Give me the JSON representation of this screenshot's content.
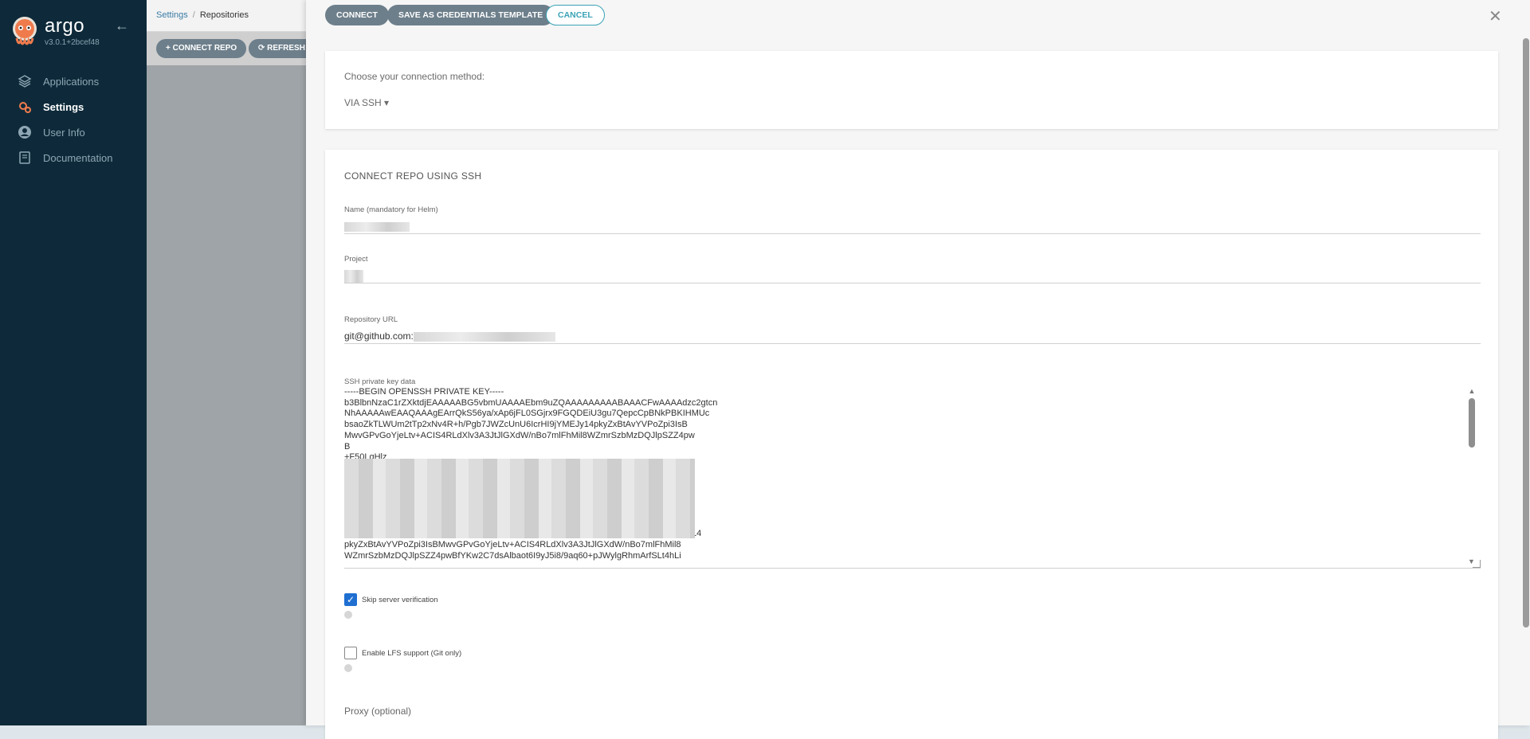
{
  "sidebar": {
    "logo_name": "argo",
    "version": "v3.0.1+2bcef48",
    "items": [
      {
        "label": "Applications",
        "icon": "layers-icon"
      },
      {
        "label": "Settings",
        "icon": "gears-icon",
        "active": true
      },
      {
        "label": "User Info",
        "icon": "user-circle-icon"
      },
      {
        "label": "Documentation",
        "icon": "book-icon"
      }
    ]
  },
  "breadcrumb": {
    "parent": "Settings",
    "current": "Repositories"
  },
  "toolbar": {
    "connect_repo": "+ CONNECT REPO",
    "refresh": "⟳ REFRESH"
  },
  "panel": {
    "connect_label": "CONNECT",
    "save_template_label": "SAVE AS CREDENTIALS TEMPLATE",
    "cancel_label": "CANCEL",
    "method_prompt": "Choose your connection method:",
    "method_value": "VIA SSH",
    "section_title": "CONNECT REPO USING SSH",
    "name_label": "Name (mandatory for Helm)",
    "project_label": "Project",
    "repo_url_label": "Repository URL",
    "repo_url_value": "git@github.com:",
    "ssh_key_label": "SSH private key data",
    "ssh_key_lines": "-----BEGIN OPENSSH PRIVATE KEY-----\nb3BlbnNzaC1rZXktdjEAAAAABG5vbmUAAAAEbm9uZQAAAAAAAAABAAACFwAAAAdzc2gtcn\nNhAAAAAwEAAQAAAgEArrQkS56ya/xAp6jFL0SGjrx9FGQDEiU3gu7QepcCpBNkPBKIHMUc\nbsaoZkTLWUm2tTp2xNv4R+h/Pgb7JWZcUnU6IcrHI9jYMEJy14pkyZxBtAvYVPoZpi3IsB\nMwvGPvGoYjeLtv+ACIS4RLdXlv3A3JtJlGXdW/nBo7mlFhMil8WZmrSzbMzDQJlpSZZ4pw\nB\n+F50LgHlz\n\n\nvQZht\nqS\nrLjLDO0+l0D3dcvXLBqRXIQ/KUaI\nsAAAdIH58FeR+fBXkAAAAHc3NoLXJzYQAAAg\ngu7QepcCpBNkPBKIHMUcbsaoZkTLWUm2tTp2xNv4R+h/Pgb7JWZcUnU6IcrHI9jYMEJy14\npkyZxBtAvYVPoZpi3IsBMwvGPvGoYjeLtv+ACIS4RLdXlv3A3JtJlGXdW/nBo7mlFhMil8\nWZmrSzbMzDQJlpSZZ4pwBfYKw2C7dsAlbaot6I9yJ5i8/9aq60+pJWylgRhmArfSLt4hLi",
    "skip_verification_label": "Skip server verification",
    "skip_verification_checked": true,
    "lfs_label": "Enable LFS support (Git only)",
    "lfs_checked": false,
    "proxy_label": "Proxy (optional)"
  }
}
